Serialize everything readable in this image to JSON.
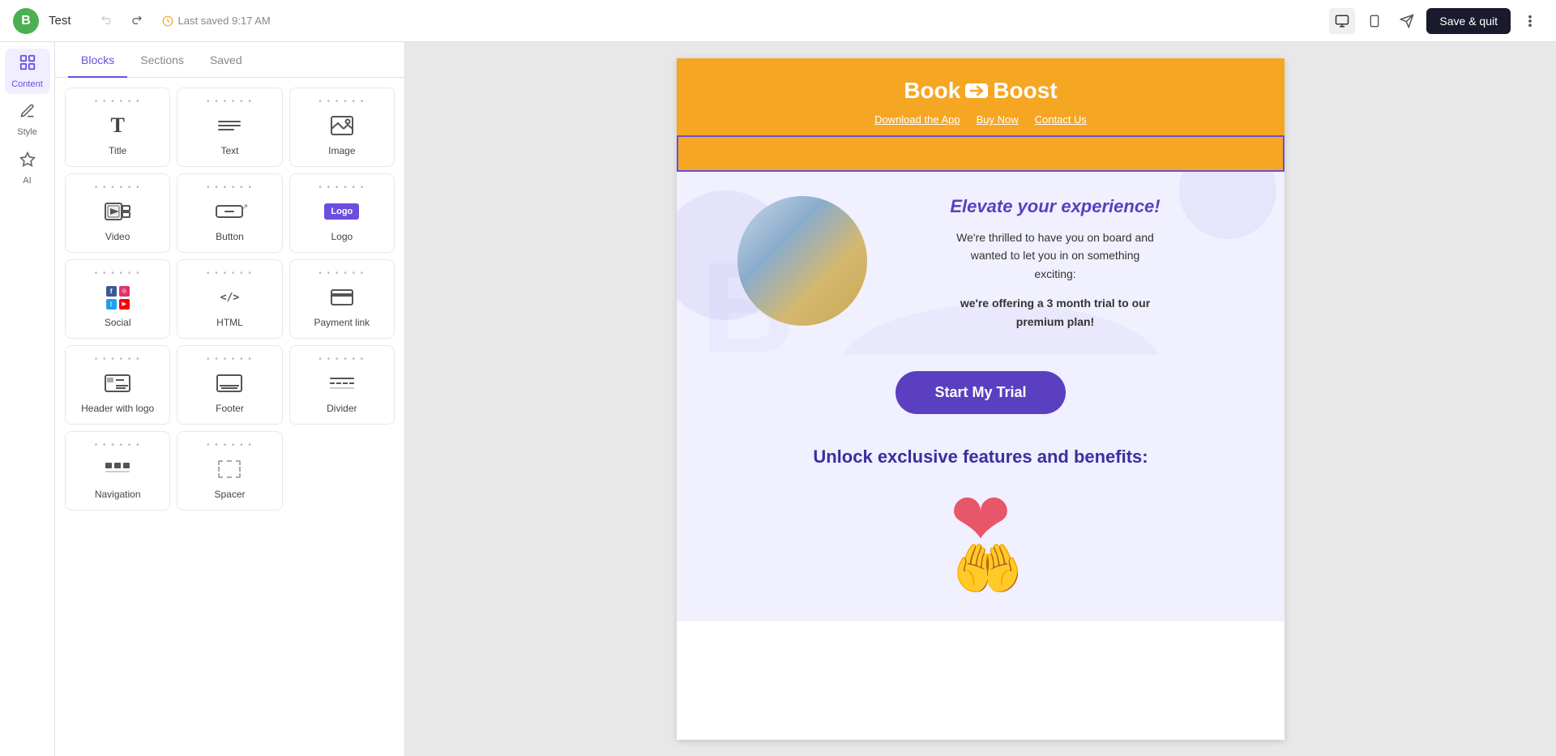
{
  "app": {
    "logo_letter": "B",
    "title": "Test",
    "saved_text": "Last saved 9:17 AM",
    "save_quit_label": "Save & quit"
  },
  "topbar": {
    "undo_label": "↩",
    "redo_label": "↪",
    "desktop_icon": "🖥",
    "tablet_icon": "📱",
    "send_icon": "✈",
    "more_icon": "⋯"
  },
  "sidebar_nav": [
    {
      "id": "content",
      "label": "Content",
      "icon": "⊞",
      "active": true
    },
    {
      "id": "style",
      "label": "Style",
      "icon": "✏"
    },
    {
      "id": "ai",
      "label": "AI",
      "icon": "✦"
    }
  ],
  "blocks_panel": {
    "tabs": [
      {
        "id": "blocks",
        "label": "Blocks",
        "active": true
      },
      {
        "id": "sections",
        "label": "Sections"
      },
      {
        "id": "saved",
        "label": "Saved"
      }
    ],
    "blocks": [
      {
        "id": "title",
        "label": "Title",
        "icon_type": "title"
      },
      {
        "id": "text",
        "label": "Text",
        "icon_type": "text"
      },
      {
        "id": "image",
        "label": "Image",
        "icon_type": "image"
      },
      {
        "id": "video",
        "label": "Video",
        "icon_type": "video"
      },
      {
        "id": "button",
        "label": "Button",
        "icon_type": "button"
      },
      {
        "id": "logo",
        "label": "Logo",
        "icon_type": "logo"
      },
      {
        "id": "social",
        "label": "Social",
        "icon_type": "social"
      },
      {
        "id": "html",
        "label": "HTML",
        "icon_type": "html"
      },
      {
        "id": "payment",
        "label": "Payment link",
        "icon_type": "payment"
      },
      {
        "id": "header-logo",
        "label": "Header with logo",
        "icon_type": "header-logo"
      },
      {
        "id": "footer",
        "label": "Footer",
        "icon_type": "footer"
      },
      {
        "id": "divider",
        "label": "Divider",
        "icon_type": "divider"
      },
      {
        "id": "navigation",
        "label": "Navigation",
        "icon_type": "navigation"
      },
      {
        "id": "spacer",
        "label": "Spacer",
        "icon_type": "spacer"
      }
    ]
  },
  "email_preview": {
    "header": {
      "brand_name_part1": "Book",
      "brand_logo_symbol": "↩",
      "brand_name_part2": "Boost",
      "nav_links": [
        "Download the App",
        "Buy Now",
        "Contact Us"
      ],
      "background_color": "#f5a623"
    },
    "hero": {
      "headline": "Elevate your experience!",
      "body_line1": "We're thrilled to have you on board and",
      "body_line2": "wanted to let you in on something",
      "body_line3": "exciting:",
      "bold_line1": "we're offering a 3 month trial to our",
      "bold_line2": "premium plan!",
      "cta_label": "Start My Trial",
      "background_color": "#f0f0ff"
    },
    "features": {
      "title": "Unlock exclusive features and benefits:",
      "background_color": "#f0f0ff"
    }
  }
}
